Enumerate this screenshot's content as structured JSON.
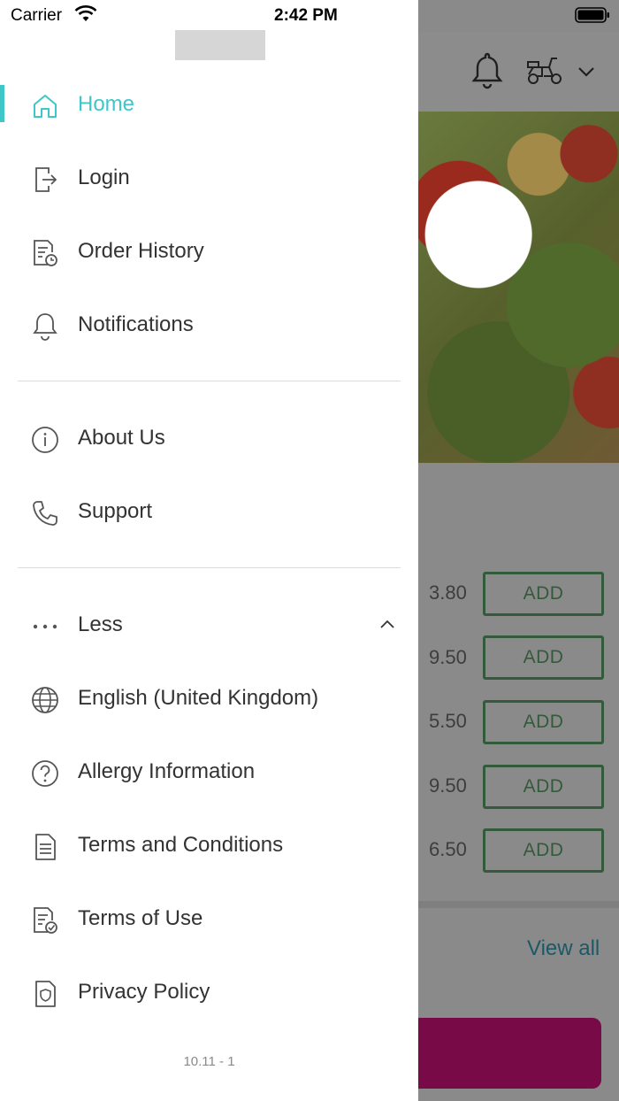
{
  "status_bar": {
    "carrier": "Carrier",
    "time": "2:42 PM"
  },
  "background": {
    "prices": [
      "3.80",
      "9.50",
      "5.50",
      "9.50",
      "6.50"
    ],
    "add_label": "ADD",
    "view_all": "View all"
  },
  "drawer": {
    "menu": {
      "home": "Home",
      "login": "Login",
      "order_history": "Order History",
      "notifications": "Notifications",
      "about_us": "About Us",
      "support": "Support",
      "less": "Less",
      "language": "English (United Kingdom)",
      "allergy": "Allergy Information",
      "terms_conditions": "Terms and Conditions",
      "terms_use": "Terms of Use",
      "privacy": "Privacy Policy"
    },
    "version": "10.11 - 1"
  },
  "colors": {
    "accent": "#3ec6c9",
    "text": "#333333",
    "icon": "#555555"
  }
}
